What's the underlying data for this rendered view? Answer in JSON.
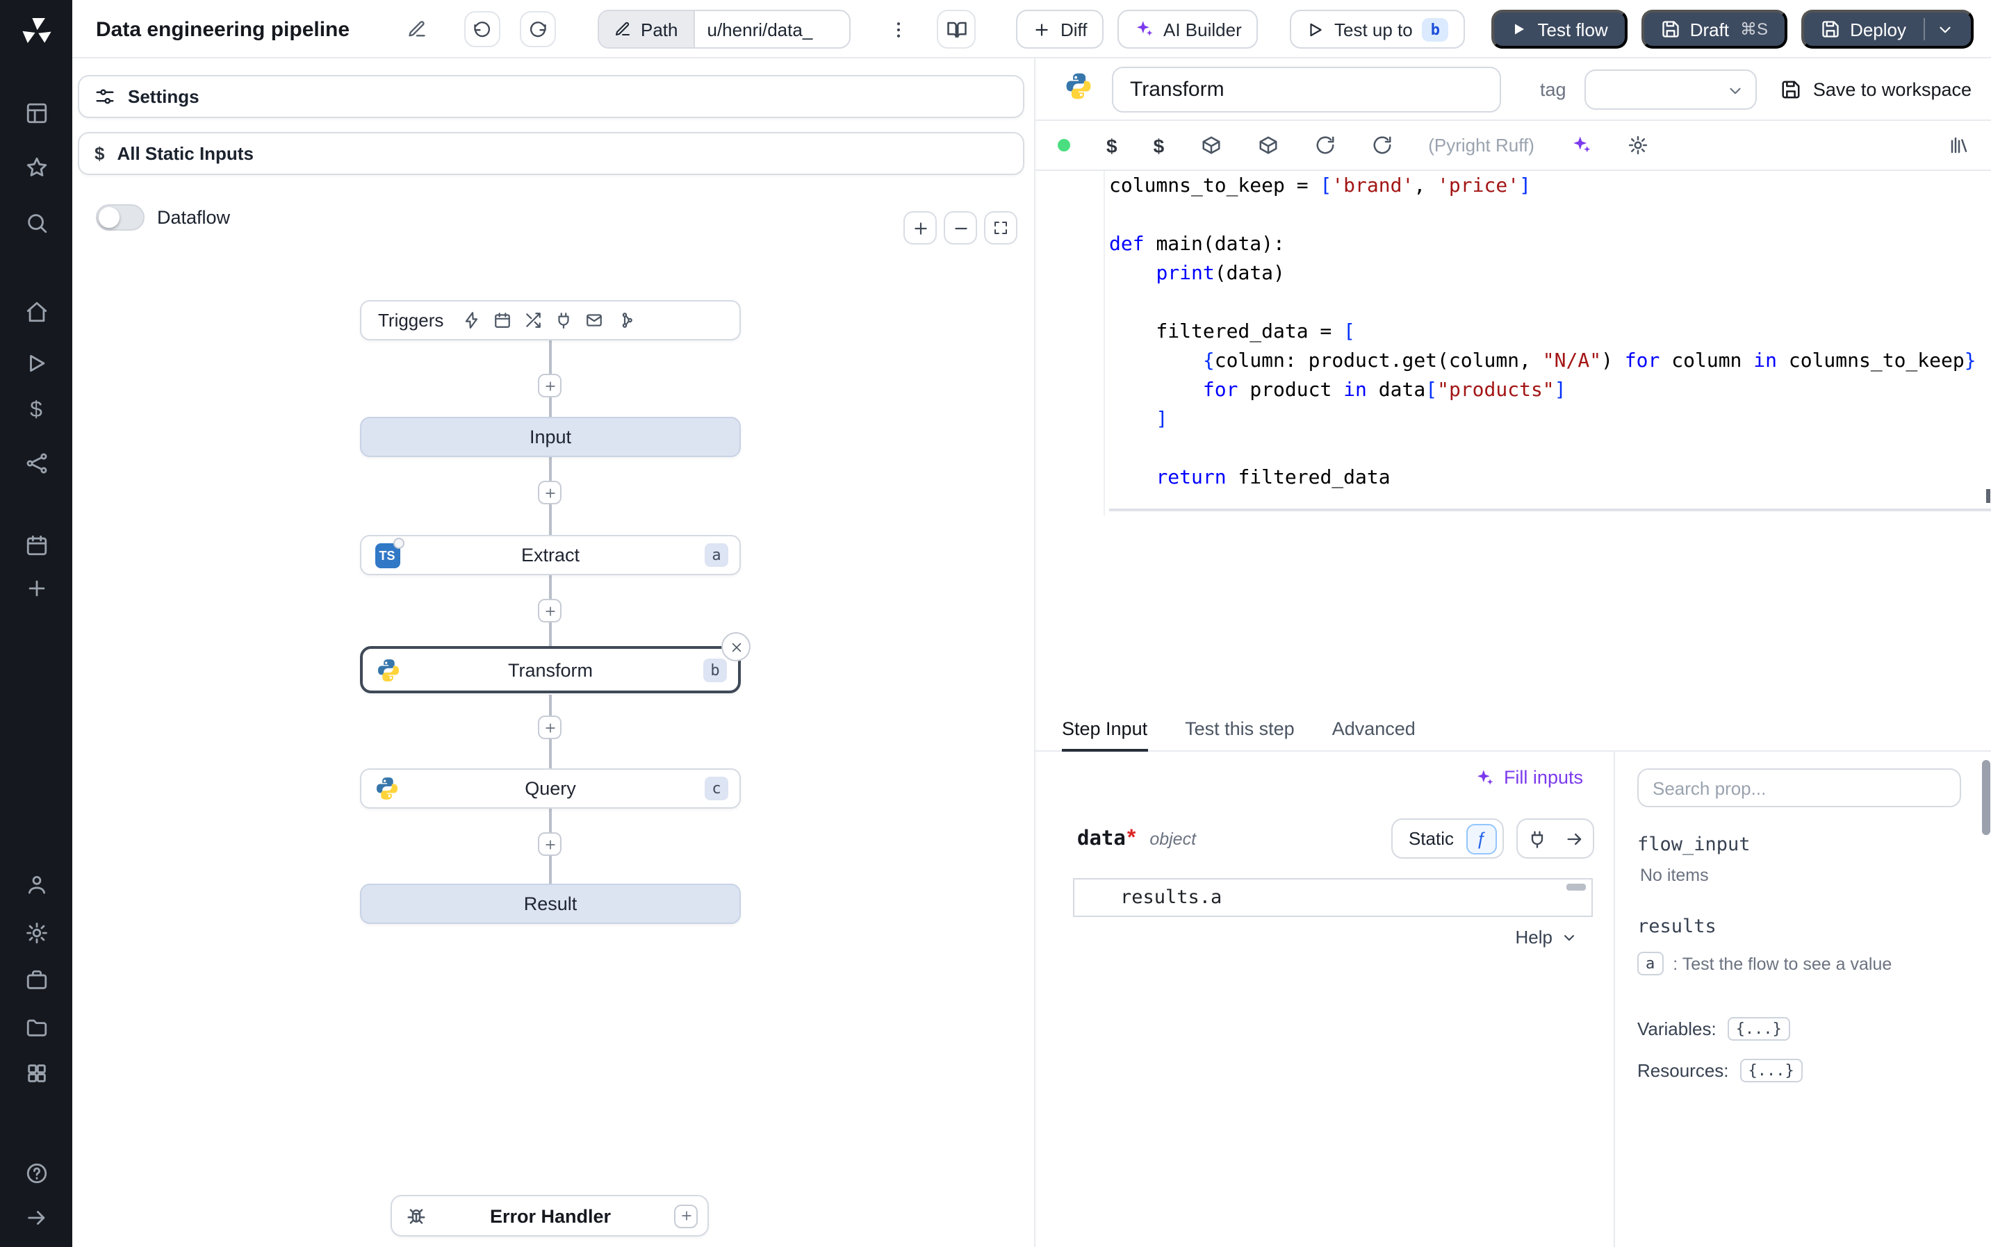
{
  "topbar": {
    "title": "Data engineering pipeline",
    "path_label": "Path",
    "path_value": "u/henri/data_",
    "diff_label": "Diff",
    "ai_builder_label": "AI Builder",
    "test_up_to_label": "Test up to",
    "test_up_to_badge": "b",
    "test_flow_label": "Test flow",
    "draft_label": "Draft",
    "draft_shortcut": "⌘S",
    "deploy_label": "Deploy"
  },
  "flow_panel": {
    "settings_label": "Settings",
    "all_static_inputs_label": "All Static Inputs",
    "dataflow_label": "Dataflow",
    "triggers_label": "Triggers",
    "nodes": {
      "input": "Input",
      "extract_label": "Extract",
      "extract_badge": "a",
      "extract_lang": "TS",
      "transform_label": "Transform",
      "transform_badge": "b",
      "query_label": "Query",
      "query_badge": "c",
      "result": "Result",
      "error_handler": "Error Handler"
    }
  },
  "editor_panel": {
    "step_name": "Transform",
    "tag_label": "tag",
    "save_to_workspace_label": "Save to workspace",
    "lint_status": "(Pyright Ruff)",
    "code": [
      "columns_to_keep = ['brand', 'price']",
      "",
      "def main(data):",
      "    print(data)",
      "",
      "    filtered_data = [",
      "        {column: product.get(column, \"N/A\") for column in columns_to_keep}",
      "        for product in data[\"products\"]",
      "    ]",
      "",
      "    return filtered_data"
    ]
  },
  "bottom_panel": {
    "tabs": [
      "Step Input",
      "Test this step",
      "Advanced"
    ],
    "active_tab": "Step Input",
    "fill_inputs_label": "Fill inputs",
    "arg_name": "data",
    "arg_required": "*",
    "arg_type": "object",
    "static_label": "Static",
    "input_value": "results.a",
    "help_label": "Help"
  },
  "props_panel": {
    "search_placeholder": "Search prop...",
    "flow_input_label": "flow_input",
    "no_items_label": "No items",
    "results_label": "results",
    "result_key": "a",
    "result_hint": ": Test the flow to see a value",
    "variables_label": "Variables:",
    "variables_value": "{...}",
    "resources_label": "Resources:",
    "resources_value": "{...}"
  },
  "colors": {
    "dark_button": "#3d4b61",
    "ai_accent": "#7c3aed",
    "status_green": "#4ade80",
    "badge_blue_bg": "#dbeafe",
    "badge_blue_text": "#1d4ed8",
    "node_badge_bg": "#dde4f3",
    "filled_node_bg": "#dce4f2",
    "ts_blue": "#3178c6",
    "python_blue": "#3776ab",
    "python_yellow": "#ffd43b",
    "code_keyword": "#0000ff",
    "code_string": "#a31515"
  }
}
